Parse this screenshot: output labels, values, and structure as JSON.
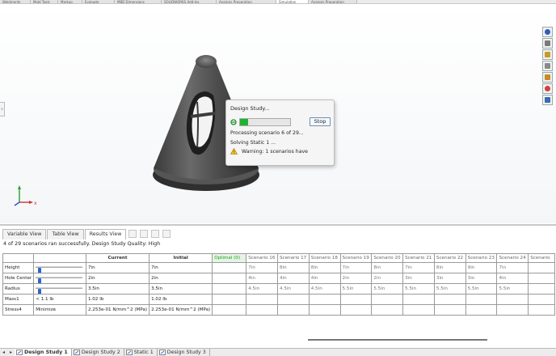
{
  "top_tabs": [
    "Weldments",
    "Mold Tools",
    "Markup",
    "Evaluate",
    "MBD Dimensions",
    "SOLIDWORKS Add-Ins",
    "Analysis Preparation",
    "Simulation",
    "Analysis Preparation"
  ],
  "top_tab_active_index": 7,
  "right_toolbar": [
    "globe-icon",
    "home-icon",
    "folder-icon",
    "bookmark-icon",
    "gallery-icon",
    "color-wheel-icon",
    "list-icon"
  ],
  "dialog": {
    "title": "Design Study...",
    "progress_percent": 16,
    "stop_label": "Stop",
    "status_line1": "Processing scenario 6 of 29...",
    "status_line2": "Solving Static 1 ...",
    "warning": "Warning: 1 scenarios have"
  },
  "panel": {
    "tabs": [
      "Variable View",
      "Table View",
      "Results View"
    ],
    "active_tab": "Results View",
    "summary": "4 of 29 scenarios ran successfully. Design Study Quality: High"
  },
  "table": {
    "headers": {
      "current": "Current",
      "initial": "Initial",
      "optimal": "Optimal (0)",
      "scenarios": [
        "Scenario 16",
        "Scenario 17",
        "Scenario 18",
        "Scenario 19",
        "Scenario 20",
        "Scenario 21",
        "Scenario 22",
        "Scenario 23",
        "Scenario 24",
        "Scenario"
      ]
    },
    "rows": [
      {
        "name": "Height",
        "slider_fraction": 0.05,
        "current": "7in",
        "initial": "7in",
        "optimal": "",
        "values": [
          "7in",
          "8in",
          "8in",
          "7in",
          "8in",
          "7in",
          "8in",
          "9in",
          "7in"
        ]
      },
      {
        "name": "Hole Center",
        "slider_fraction": 0.05,
        "current": "2in",
        "initial": "2in",
        "optimal": "",
        "values": [
          "4in",
          "4in",
          "4in",
          "2in",
          "2in",
          "3in",
          "3in",
          "3in",
          "4in"
        ]
      },
      {
        "name": "Radius",
        "slider_fraction": 0.05,
        "current": "3.5in",
        "initial": "3.5in",
        "optimal": "",
        "values": [
          "4.5in",
          "4.5in",
          "4.5in",
          "5.5in",
          "5.5in",
          "5.5in",
          "5.5in",
          "5.5in",
          "5.5in"
        ]
      },
      {
        "name": "Mass1",
        "setting": "< 1.1 lb",
        "current": "1.02 lb",
        "initial": "1.02 lb",
        "optimal": "",
        "values": [
          "",
          "",
          "",
          "",
          "",
          "",
          "",
          "",
          ""
        ]
      },
      {
        "name": "Stress4",
        "setting": "Minimize",
        "current": "2.253e-01 N/mm^2 (MPa)",
        "initial": "2.253e-01 N/mm^2 (MPa)",
        "optimal": "",
        "values": [
          "",
          "",
          "",
          "",
          "",
          "",
          "",
          "",
          ""
        ]
      }
    ]
  },
  "sheet_tabs": [
    {
      "label": "Design Study 1",
      "active": true
    },
    {
      "label": "Design Study 2",
      "active": false
    },
    {
      "label": "Static 1",
      "active": false
    },
    {
      "label": "Design Study 3",
      "active": false
    }
  ],
  "colors": {
    "progress": "#1db330",
    "optimal_header": "#19a019",
    "slider_thumb": "#2a67c9",
    "stop_border": "#6a8fc0"
  }
}
